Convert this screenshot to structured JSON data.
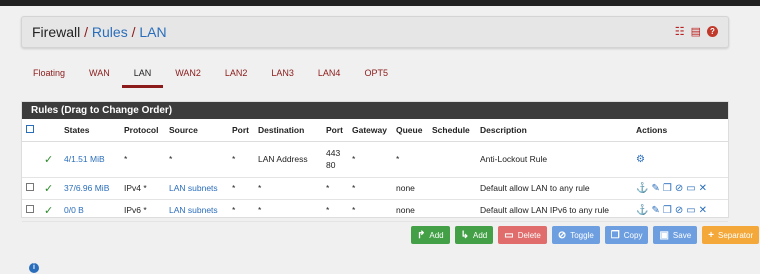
{
  "breadcrumb": {
    "root": "Firewall",
    "sep": "/",
    "level1": "Rules",
    "level2": "LAN"
  },
  "tabs": [
    "Floating",
    "WAN",
    "LAN",
    "WAN2",
    "LAN2",
    "LAN3",
    "LAN4",
    "OPT5"
  ],
  "active_tab": "LAN",
  "panel": {
    "title": "Rules (Drag to Change Order)"
  },
  "columns": [
    "States",
    "Protocol",
    "Source",
    "Port",
    "Destination",
    "Port",
    "Gateway",
    "Queue",
    "Schedule",
    "Description",
    "Actions"
  ],
  "rows": [
    {
      "states": "4/1.51 MiB",
      "protocol": "*",
      "source": "*",
      "sport": "*",
      "destination": "LAN Address",
      "dport": "443\n80",
      "gateway": "*",
      "queue": "*",
      "schedule": "",
      "description": "Anti-Lockout Rule"
    },
    {
      "states": "37/6.96 MiB",
      "protocol": "IPv4 *",
      "source": "LAN subnets",
      "sport": "*",
      "destination": "*",
      "dport": "*",
      "gateway": "*",
      "queue": "none",
      "schedule": "",
      "description": "Default allow LAN to any rule"
    },
    {
      "states": "0/0 B",
      "protocol": "IPv6 *",
      "source": "LAN subnets",
      "sport": "*",
      "destination": "*",
      "dport": "*",
      "gateway": "*",
      "queue": "none",
      "schedule": "",
      "description": "Default allow LAN IPv6 to any rule"
    }
  ],
  "buttons": {
    "add_top": "Add",
    "add_bottom": "Add",
    "delete": "Delete",
    "toggle": "Toggle",
    "copy": "Copy",
    "save": "Save",
    "separator": "Separator"
  },
  "colors": {
    "accent": "#8b1a1a",
    "link": "#2a6ebb",
    "green": "#43a047",
    "orange": "#f4a83a"
  }
}
